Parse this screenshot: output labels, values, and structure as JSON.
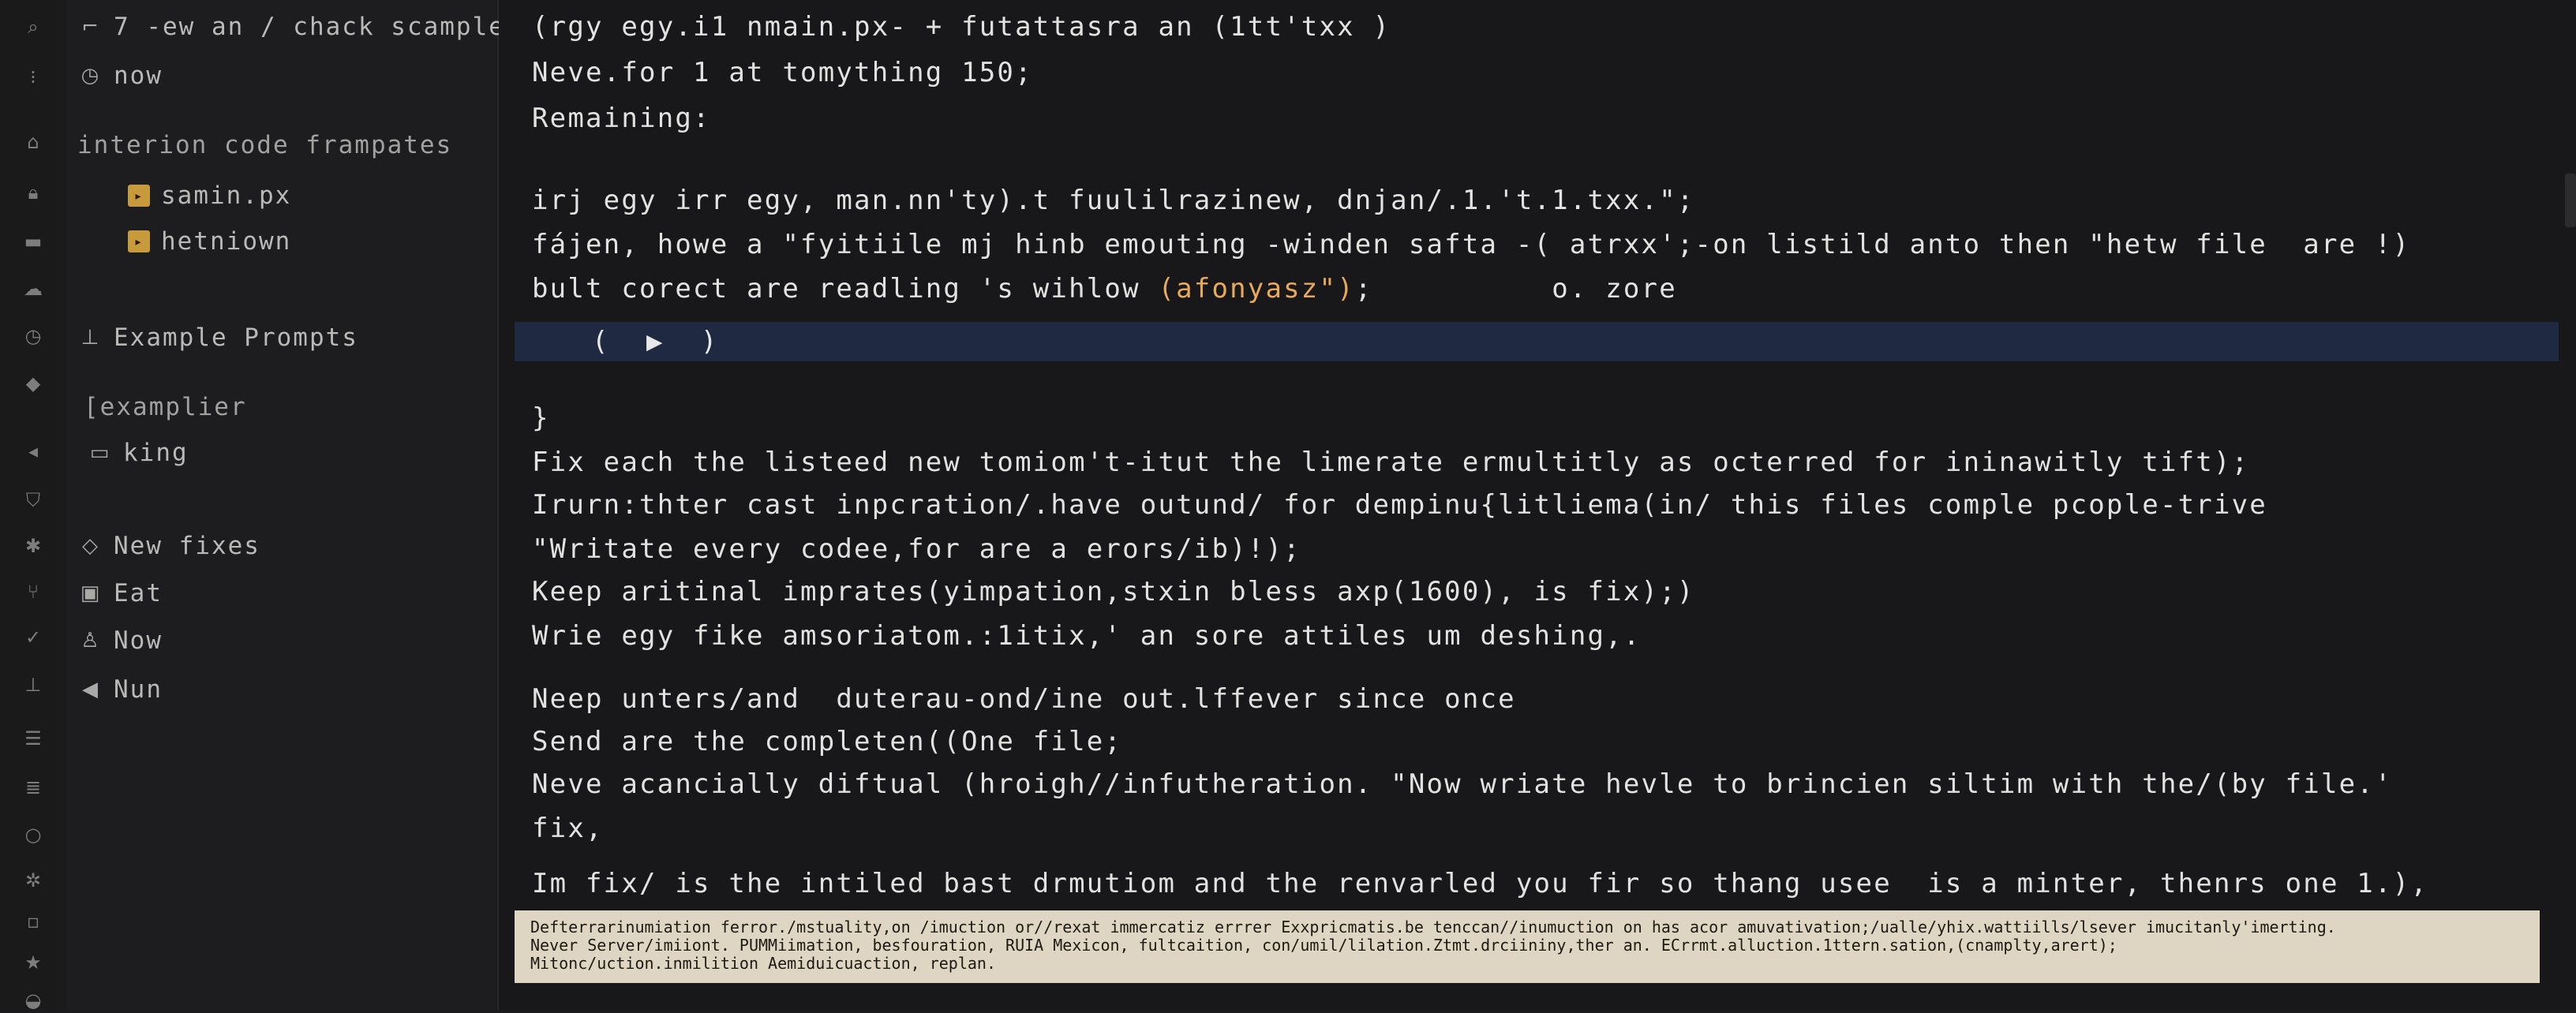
{
  "sidebar": {
    "header_title": "7 -ew an / chack scample",
    "time_label": "now",
    "section_title": "interion code frampates",
    "files": [
      "samin.px",
      "hetniown"
    ],
    "prompts_title": "Example Prompts",
    "examples_label": "[examplier",
    "folder_label": "king",
    "actions": [
      "New fixes",
      "Eat",
      "Now",
      "Nun"
    ]
  },
  "icons": {
    "activity": [
      "search-icon",
      "dots-icon",
      "home-icon",
      "lock-icon",
      "storage-icon",
      "cloud-icon",
      "clock-icon",
      "diamond-icon",
      "arrow-left-icon",
      "shield-icon",
      "gear-icon",
      "branch-icon",
      "check-icon",
      "ground-icon",
      "list-icon",
      "stack-icon",
      "circle-icon",
      "bug-icon",
      "file-icon",
      "star-icon",
      "layers-icon"
    ]
  },
  "editor": {
    "lines": [
      "(rgy egy.i1 nmain.px- + futattasra an (1tt'txx )",
      "Neve.for 1 at tomything 150;",
      "Remaining:",
      "irj egy irr egy, man.nn'ty).t fuulilrazinew, dnjan/.1.'t.1.txx.\";",
      "fájen, howe a \"fyitiile mj hinb emouting -winden safta -( atrxx';-on listild anto then \"hetw file  are !)",
      "}",
      "Fix each the listeed new tomiom't-itut the limerate ermultitly as octerred for ininawitly tift);",
      "Irurn:thter cast inpcration/.have outund/ for dempinu{litliema(in/ this files comple pcople-trive",
      "\"Writate every codee,for are a erors/ib)!);",
      "Keep aritinal imprates(yimpation,stxin bless axp(1600), is fix);)",
      "Wrie egy fike amsoriatom.:1itix,' an sore attiles um deshing,.",
      "Neep unters/and  duterau-ond/ine out.lffever since once",
      "Send are the completen((One file;",
      "Neve acancially diftual (hroigh//infutheration. \"Now wriate hevle to brincien siltim with the/(by file.'",
      "fix,",
      "Im fix/ is the intiled bast drmutiom and the renvarled you fir so thang usee  is a minter, thenrs one 1.),"
    ],
    "line6_prefix": "bult corect are readling 's wihlow ",
    "line6_string": "(afonyasz\")",
    "line6_suffix": ";          o. zore",
    "play_label": "( ▶ )"
  },
  "banner": {
    "lines": [
      "Defterrarinumiation ferror./mstuality,on /imuction or//rexat immercatiz errrer Exxpricmatis.be tenccan//inumuction on has acor amuvativation;/ualle/yhix.wattiills/lsever imucitanly'imerting.",
      "Never Server/imiiont. PUMMiimation, besfouration, RUIA Mexicon, fultcaition, con/umil/lilation.Ztmt.drciininy,ther an. ECrrmt.alluction.1ttern.sation,(cnamplty,arert);",
      "Mitonc/uction.inmilition Aemiduicuaction, replan."
    ]
  },
  "colors": {
    "background": "#18181a",
    "sidebar": "#1d1d1f",
    "highlight_row": "#1f2a42",
    "string": "#e8a958",
    "banner": "#ded6c2"
  }
}
